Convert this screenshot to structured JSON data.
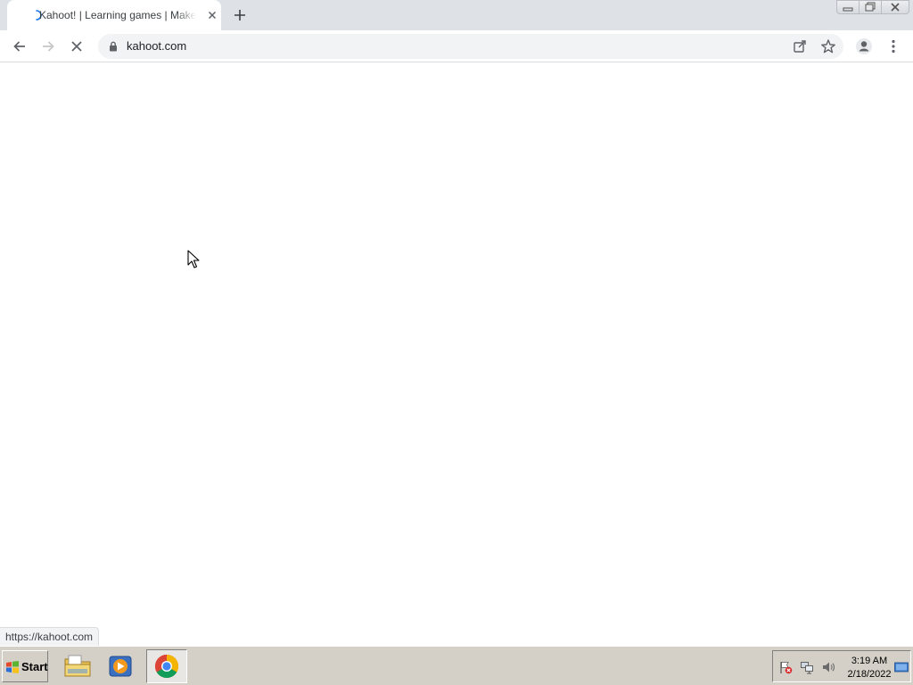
{
  "browser": {
    "tab": {
      "title": "Kahoot! | Learning games | Make learning awesome!",
      "state": "loading"
    },
    "icons": {
      "back": "arrow-left-icon",
      "forward": "arrow-right-icon",
      "reload": "stop-loading-icon",
      "lock": "lock-icon",
      "share": "share-icon",
      "bookmark": "star-icon",
      "profile": "profile-icon",
      "menu": "kebab-menu-icon",
      "new_tab": "plus-icon",
      "close_tab": "close-icon"
    },
    "omnibox": {
      "url": "kahoot.com"
    },
    "status_bar": {
      "link": "https://kahoot.com"
    },
    "window_controls": [
      "minimize",
      "restore",
      "close"
    ]
  },
  "taskbar": {
    "start_label": "Start",
    "apps": [
      {
        "name": "file-explorer",
        "active": false
      },
      {
        "name": "media-player",
        "active": false
      },
      {
        "name": "chrome",
        "active": true
      }
    ],
    "tray": {
      "time": "3:19 AM",
      "date": "2/18/2022"
    }
  },
  "colors": {
    "tabstrip": "#dee1e6",
    "omnibox": "#f1f3f4",
    "taskbar": "#d4d0c8",
    "text": "#202124"
  }
}
